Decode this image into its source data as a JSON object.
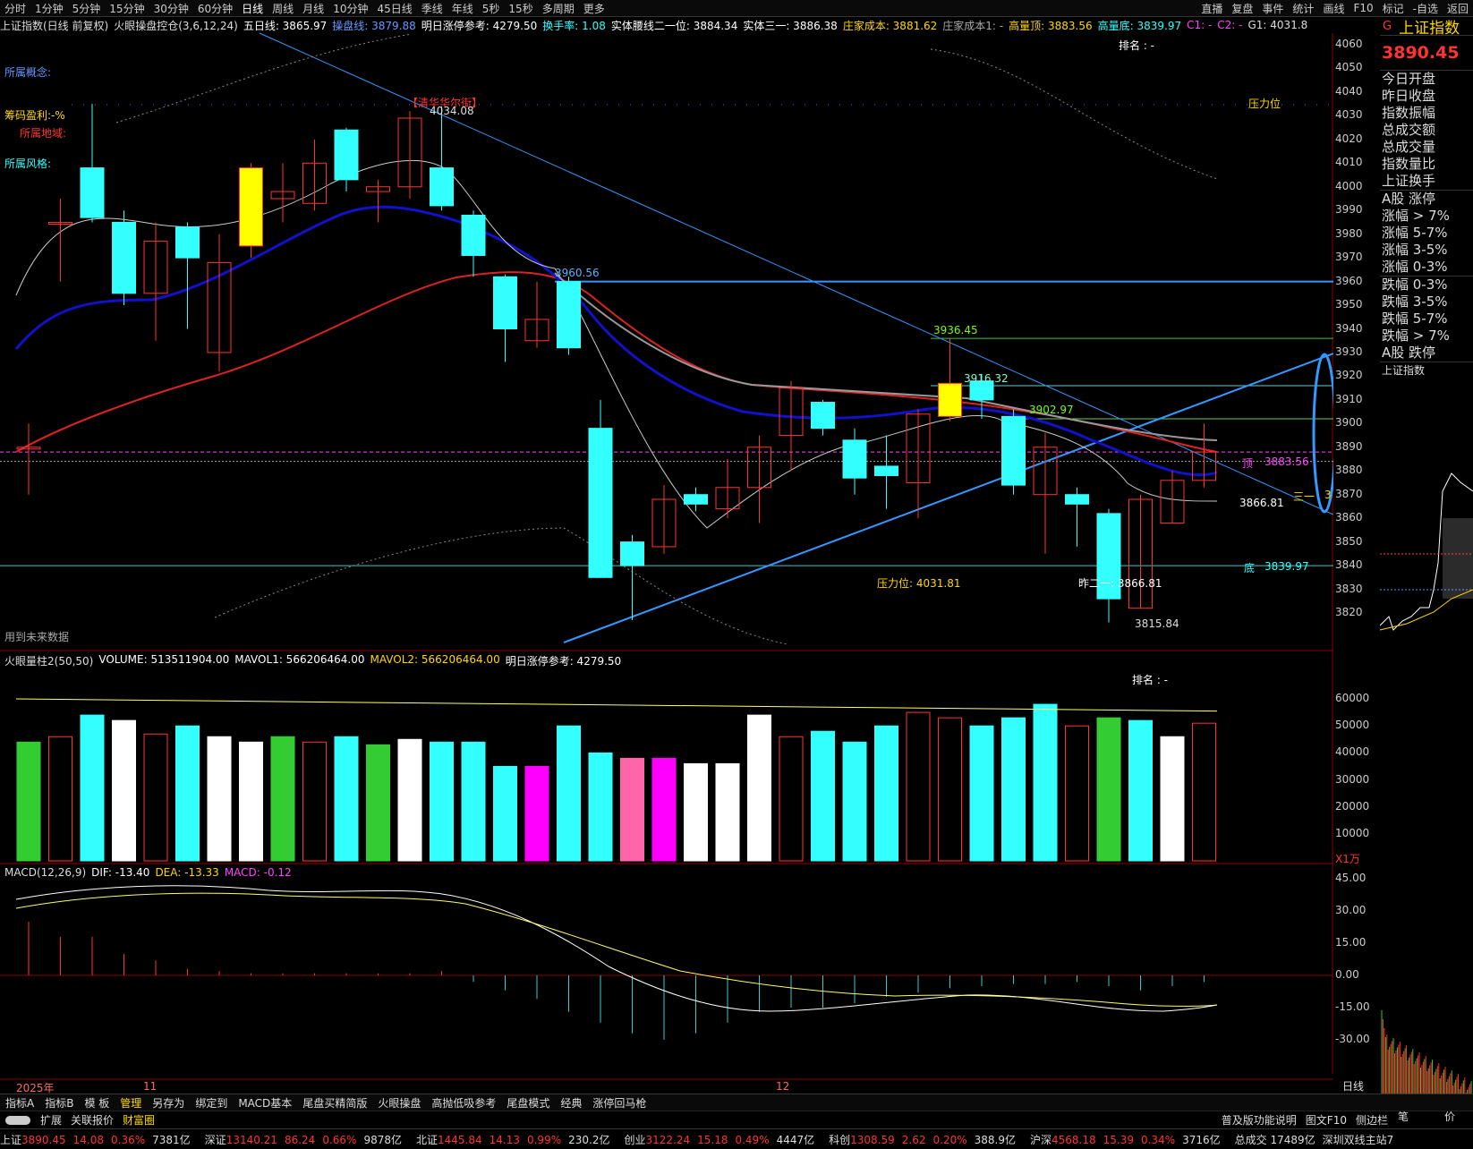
{
  "top_tabs": [
    "分时",
    "1分钟",
    "5分钟",
    "15分钟",
    "30分钟",
    "60分钟",
    "日线",
    "周线",
    "月线",
    "10分钟",
    "45日线",
    "季线",
    "年线",
    "5秒",
    "15秒",
    "多周期",
    "更多"
  ],
  "top_right": [
    "直播",
    "复盘",
    "事件",
    "统计",
    "画线",
    "F10",
    "标记",
    "-自选",
    "返回"
  ],
  "index_name": "上证指数",
  "index_price": "3890.45",
  "info": {
    "title": "上证指数(日线 前复权)",
    "indicator": "火眼操盘控仓(3,6,12,24)",
    "ma5": "五日线: 3865.97",
    "cpx": "操盘线: 3879.88",
    "next_limit": "明日涨停参考: 4279.50",
    "turnover": "换手率: 1.08",
    "waist": "实体腰线二一位: 3884.34",
    "solid3": "实体三一: 3886.38",
    "cost": "庄家成本: 3881.62",
    "cost1": "庄家成本1: -",
    "high_top": "高量顶: 3883.56",
    "high_bot": "高量底: 3839.97",
    "c1": "C1: -",
    "c2": "C2: -",
    "g1": "G1: 4031.8"
  },
  "left_labels": {
    "concept": "所属概念:",
    "profit": "筹码盈利:-%",
    "region": "所属地域:",
    "style": "所属风格:",
    "future": "用到未来数据",
    "rank": "排名 : -",
    "marker": "【清华华尔街】"
  },
  "price_labels": {
    "peak": "4034.08",
    "l3960": "3960.56",
    "l3936": "3936.45",
    "l3916": "3916.32",
    "l3902": "3902.97",
    "top_label": "顶",
    "top_val": "3883.56",
    "l3866": "3866.81",
    "bottom_label": "底",
    "bottom_val": "3839.97",
    "pressure": "压力位: 4031.81",
    "pressure_tag": "压力位",
    "yest2": "昨二一: 3866.81",
    "low": "3815.84",
    "sanyi": "三一",
    "sanyi_val": "3"
  },
  "price_axis": [
    "4060",
    "4050",
    "4040",
    "4030",
    "4020",
    "4010",
    "4000",
    "3990",
    "3980",
    "3970",
    "3960",
    "3950",
    "3940",
    "3930",
    "3920",
    "3910",
    "3900",
    "3890",
    "3880",
    "3870",
    "3860",
    "3850",
    "3840",
    "3830",
    "3820"
  ],
  "volume_info": {
    "title": "火眼量柱2(50,50)",
    "volume": "VOLUME: 513511904.00",
    "mavol1": "MAVOL1: 566206464.00",
    "mavol2": "MAVOL2: 566206464.00",
    "limit": "明日涨停参考: 4279.50",
    "rank": "排名 : -",
    "unit": "X1万"
  },
  "volume_axis": [
    "60000",
    "50000",
    "40000",
    "30000",
    "20000",
    "10000"
  ],
  "macd_info": {
    "title": "MACD(12,26,9)",
    "dif": "DIF: -13.40",
    "dea": "DEA: -13.33",
    "macd": "MACD: -0.12"
  },
  "macd_axis": [
    "45.00",
    "30.00",
    "15.00",
    "0.00",
    "-15.00",
    "-30.00"
  ],
  "date_axis": {
    "year": "2025年",
    "m11": "11",
    "m12": "12",
    "period": "日线"
  },
  "side_rows": [
    "今日开盘",
    "昨日收盘",
    "指数振幅",
    "总成交额",
    "总成交量",
    "指数量比",
    "上证换手",
    "A股 涨停",
    "涨幅 > 7%",
    "涨幅 5-7%",
    "涨幅 3-5%",
    "涨幅 0-3%",
    "跌幅 0-3%",
    "跌幅 3-5%",
    "跌幅 5-7%",
    "跌幅 > 7%",
    "A股 跌停",
    "上证指数"
  ],
  "bottom_tabs": [
    "指标A",
    "指标B",
    "模 板",
    "管理",
    "另存为",
    "绑定到",
    "MACD基本",
    "尾盘买精简版",
    "火眼操盘",
    "高抛低吸参考",
    "尾盘模式",
    "经典",
    "涨停回马枪"
  ],
  "bottom_tabs2": [
    "扩展",
    "关联报价",
    "财富圈"
  ],
  "bottom_right": [
    "普及版功能说明",
    "图文F10",
    "侧边栏"
  ],
  "side_bottom": [
    "笔",
    "价"
  ],
  "status": [
    {
      "name": "上证",
      "val": "3890.45",
      "chg": "14.08",
      "pct": "0.36%",
      "amt": "7381亿"
    },
    {
      "name": "深证",
      "val": "13140.21",
      "chg": "86.24",
      "pct": "0.66%",
      "amt": "9878亿"
    },
    {
      "name": "北证",
      "val": "1445.84",
      "chg": "14.13",
      "pct": "0.99%",
      "amt": "230.2亿"
    },
    {
      "name": "创业",
      "val": "3122.24",
      "chg": "15.18",
      "pct": "0.49%",
      "amt": "4447亿"
    },
    {
      "name": "科创",
      "val": "1308.59",
      "chg": "2.62",
      "pct": "0.20%",
      "amt": "388.9亿"
    },
    {
      "name": "沪深",
      "val": "4568.18",
      "chg": "15.39",
      "pct": "0.34%",
      "amt": "3716亿"
    }
  ],
  "status_total": "总成交 17489亿",
  "status_tail": "深圳双线主站7",
  "chart_data": {
    "type": "candlestick",
    "ylim": [
      3810,
      4065
    ],
    "candles": [
      {
        "o": 3890,
        "c": 3890,
        "h": 3900,
        "l": 3870
      },
      {
        "o": 3985,
        "c": 3985,
        "h": 3995,
        "l": 3960
      },
      {
        "o": 4008,
        "c": 3987,
        "h": 4035,
        "l": 3985
      },
      {
        "o": 3985,
        "c": 3955,
        "h": 3990,
        "l": 3950
      },
      {
        "o": 3955,
        "c": 3977,
        "h": 3985,
        "l": 3935
      },
      {
        "o": 3983,
        "c": 3970,
        "h": 3985,
        "l": 3940
      },
      {
        "o": 3930,
        "c": 3968,
        "h": 3980,
        "l": 3922
      },
      {
        "o": 3975,
        "c": 4008,
        "h": 4010,
        "l": 3970
      },
      {
        "o": 3995,
        "c": 3998,
        "h": 4010,
        "l": 3985
      },
      {
        "o": 3993,
        "c": 4010,
        "h": 4020,
        "l": 3990
      },
      {
        "o": 4024,
        "c": 4003,
        "h": 4025,
        "l": 3998
      },
      {
        "o": 3998,
        "c": 4000,
        "h": 4003,
        "l": 3985
      },
      {
        "o": 4000,
        "c": 4029,
        "h": 4032,
        "l": 3995
      },
      {
        "o": 4008,
        "c": 3992,
        "h": 4034,
        "l": 3990
      },
      {
        "o": 3988,
        "c": 3971,
        "h": 3990,
        "l": 3962
      },
      {
        "o": 3962,
        "c": 3940,
        "h": 3963,
        "l": 3926
      },
      {
        "o": 3935,
        "c": 3944,
        "h": 3960,
        "l": 3932
      },
      {
        "o": 3960,
        "c": 3932,
        "h": 3962,
        "l": 3929
      },
      {
        "o": 3898,
        "c": 3835,
        "h": 3910,
        "l": 3835
      },
      {
        "o": 3850,
        "c": 3840,
        "h": 3853,
        "l": 3817
      },
      {
        "o": 3848,
        "c": 3868,
        "h": 3874,
        "l": 3845
      },
      {
        "o": 3870,
        "c": 3866,
        "h": 3873,
        "l": 3863
      },
      {
        "o": 3864,
        "c": 3873,
        "h": 3885,
        "l": 3860
      },
      {
        "o": 3873,
        "c": 3890,
        "h": 3895,
        "l": 3858
      },
      {
        "o": 3895,
        "c": 3915,
        "h": 3918,
        "l": 3880
      },
      {
        "o": 3909,
        "c": 3898,
        "h": 3910,
        "l": 3895
      },
      {
        "o": 3893,
        "c": 3877,
        "h": 3898,
        "l": 3870
      },
      {
        "o": 3882,
        "c": 3878,
        "h": 3895,
        "l": 3864
      },
      {
        "o": 3875,
        "c": 3904,
        "h": 3906,
        "l": 3860
      },
      {
        "o": 3903,
        "c": 3917,
        "h": 3936,
        "l": 3901
      },
      {
        "o": 3918,
        "c": 3910,
        "h": 3921,
        "l": 3902
      },
      {
        "o": 3903,
        "c": 3874,
        "h": 3906,
        "l": 3870
      },
      {
        "o": 3870,
        "c": 3890,
        "h": 3896,
        "l": 3845
      },
      {
        "o": 3870,
        "c": 3866,
        "h": 3873,
        "l": 3848
      },
      {
        "o": 3862,
        "c": 3826,
        "h": 3864,
        "l": 3816
      },
      {
        "o": 3822,
        "c": 3868,
        "h": 3870,
        "l": 3822
      },
      {
        "o": 3858,
        "c": 3876,
        "h": 3880,
        "l": 3858
      },
      {
        "o": 3876,
        "c": 3888,
        "h": 3900,
        "l": 3873
      }
    ],
    "volume": [
      44000,
      46000,
      54000,
      52000,
      47000,
      50000,
      46000,
      44000,
      46000,
      44000,
      46000,
      43000,
      45000,
      44000,
      44000,
      35000,
      35000,
      50000,
      40000,
      38000,
      38000,
      36000,
      36000,
      54000,
      46000,
      48000,
      44000,
      50000,
      55000,
      53000,
      50000,
      53000,
      58000,
      50000,
      53000,
      52000,
      46000,
      51000
    ]
  }
}
